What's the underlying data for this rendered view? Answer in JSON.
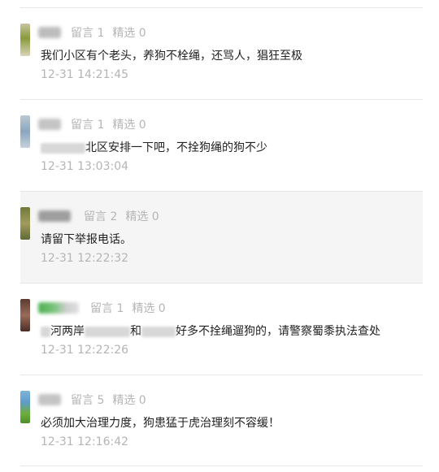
{
  "comments": [
    {
      "likes_label": "留言 1",
      "picks_label": "精选 0",
      "text": "我们小区有个老头，养狗不栓绳，还骂人，猖狂至极",
      "time": "12-31 14:21:45"
    },
    {
      "likes_label": "留言 1",
      "picks_label": "精选 0",
      "text_visible": "北区安排一下吧，不拴狗绳的狗不少",
      "time": "12-31 13:03:04"
    },
    {
      "likes_label": "留言 2",
      "picks_label": "精选 0",
      "text": "请留下举报电话。",
      "time": "12-31 12:22:32"
    },
    {
      "likes_label": "留言 1",
      "picks_label": "精选 0",
      "text_a": "河两岸",
      "text_b": "和",
      "text_c": "好多不拴绳遛狗的，请警察蜀黍执法查处",
      "time": "12-31 12:22:26"
    },
    {
      "likes_label": "留言 5",
      "picks_label": "精选 0",
      "text": "必须加大治理力度，狗患猛于虎治理刻不容缓！",
      "time": "12-31 12:16:42"
    }
  ],
  "colors": {
    "meta_text": "#b5b5b5",
    "body_text": "#222222",
    "divider": "#e6e6e6",
    "highlight_bg": "#f5f5f5"
  }
}
